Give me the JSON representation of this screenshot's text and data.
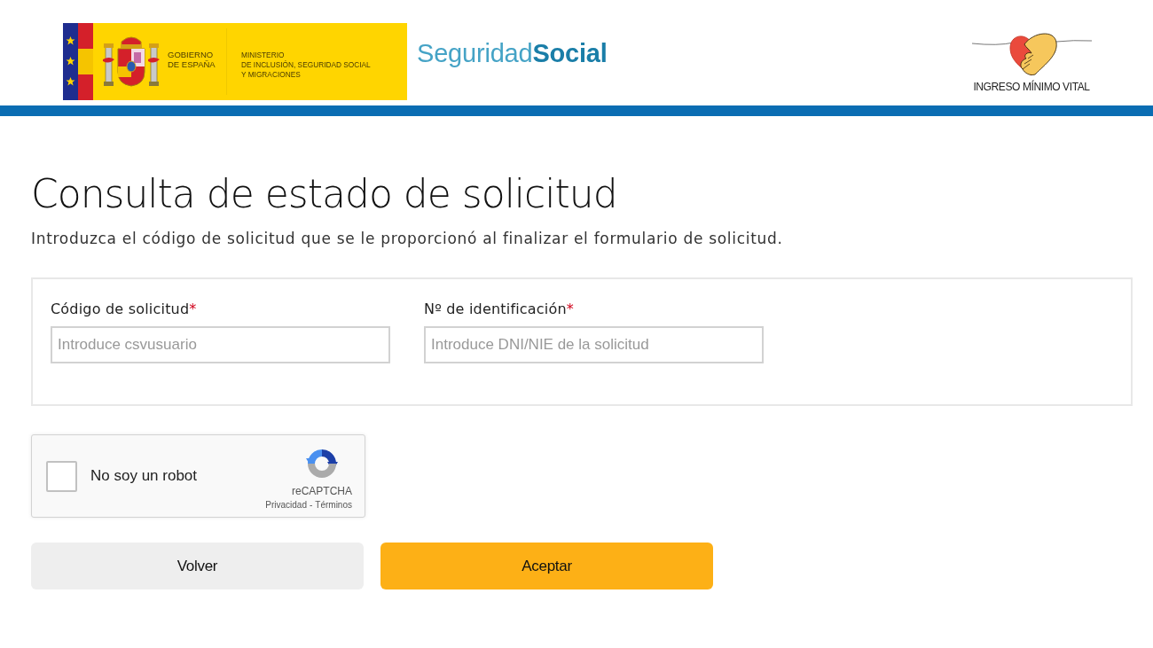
{
  "header": {
    "government_logo": {
      "government_lines": [
        "GOBIERNO",
        "DE ESPAÑA"
      ],
      "ministry_lines": [
        "MINISTERIO",
        "DE INCLUSIÓN, SEGURIDAD SOCIAL",
        "Y MIGRACIONES"
      ]
    },
    "brand": {
      "light_part": "Seguridad",
      "bold_part": "Social"
    },
    "program_logo": {
      "caption": "INGRESO MÍNIMO VITAL"
    }
  },
  "page": {
    "title": "Consulta de estado de solicitud",
    "subtitle": "Introduzca el código de solicitud que se le proporcionó al finalizar el formulario de solicitud."
  },
  "form": {
    "fields": [
      {
        "label": "Código de solicitud",
        "required_mark": "*",
        "placeholder": "Introduce csvusuario"
      },
      {
        "label": "Nº de identificación",
        "required_mark": "*",
        "placeholder": "Introduce DNI/NIE de la solicitud"
      }
    ]
  },
  "captcha": {
    "checked": false,
    "label": "No soy un robot",
    "brand": "reCAPTCHA",
    "links": [
      "Privacidad",
      "Términos"
    ],
    "separator": "-"
  },
  "buttons": [
    {
      "label": "Volver",
      "kind": "secondary"
    },
    {
      "label": "Aceptar",
      "kind": "primary"
    }
  ]
}
